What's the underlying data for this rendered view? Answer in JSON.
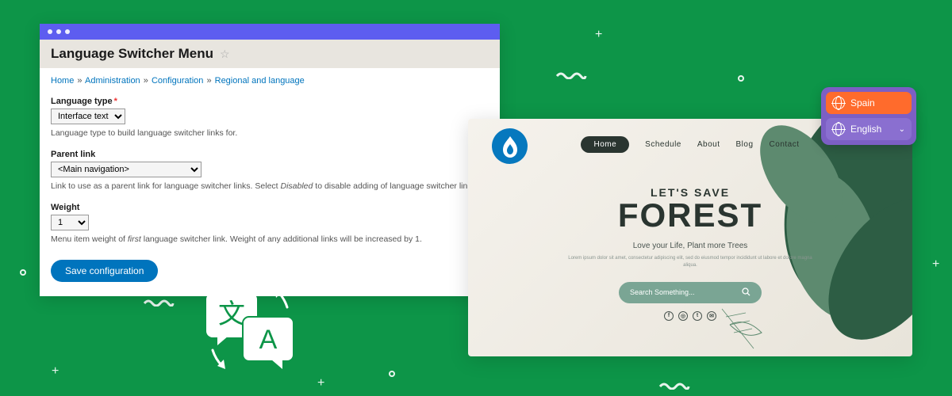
{
  "admin": {
    "title": "Language Switcher Menu",
    "breadcrumb": {
      "items": [
        "Home",
        "Administration",
        "Configuration",
        "Regional and language"
      ]
    },
    "fields": {
      "language_type": {
        "label": "Language type",
        "required": true,
        "value": "Interface text",
        "description": "Language type to build language switcher links for."
      },
      "parent_link": {
        "label": "Parent link",
        "value": "<Main navigation>",
        "description_1": "Link to use as a parent link for language switcher links. Select ",
        "description_em": "Disabled",
        "description_2": " to disable adding of language switcher links."
      },
      "weight": {
        "label": "Weight",
        "value": "1",
        "description_1": "Menu item weight of ",
        "description_em": "first",
        "description_2": " language switcher link. Weight of any additional links will be increased by 1."
      }
    },
    "save_label": "Save configuration"
  },
  "site": {
    "nav": {
      "items": [
        "Home",
        "Schedule",
        "About",
        "Blog",
        "Contact"
      ],
      "active_index": 0
    },
    "hero": {
      "eyebrow": "LET'S SAVE",
      "title": "FOREST",
      "tagline": "Love your Life, Plant more Trees",
      "lorem": "Lorem ipsum dolor sit amet, consectetur adipiscing elit, sed do eiusmod tempor incididunt ut labore et dolore magna aliqua."
    },
    "search": {
      "placeholder": "Search Something..."
    }
  },
  "lang_switcher": {
    "options": [
      {
        "label": "Spain",
        "active": true
      },
      {
        "label": "English",
        "active": false
      }
    ]
  }
}
